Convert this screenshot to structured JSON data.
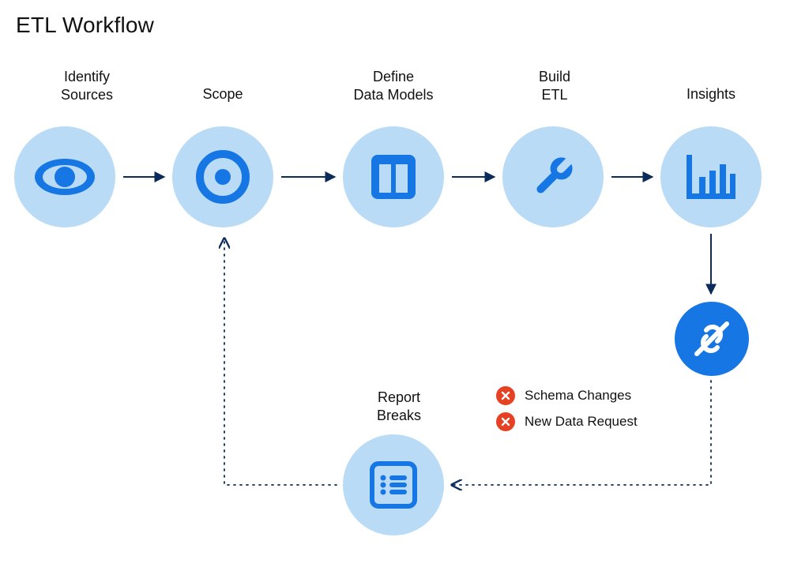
{
  "title": "ETL Workflow",
  "nodes": {
    "identify": {
      "label": "Identify\nSources"
    },
    "scope": {
      "label": "Scope"
    },
    "define": {
      "label": "Define\nData Models"
    },
    "build": {
      "label": "Build\nETL"
    },
    "insights": {
      "label": "Insights"
    },
    "report": {
      "label": "Report\nBreaks"
    }
  },
  "issues": {
    "schema": {
      "label": "Schema Changes"
    },
    "newdata": {
      "label": "New Data Request"
    }
  },
  "colors": {
    "lightBlue": "#B9DBF6",
    "primaryBlue": "#1676E3",
    "navyArrow": "#0B2B5A",
    "red": "#E74124"
  }
}
